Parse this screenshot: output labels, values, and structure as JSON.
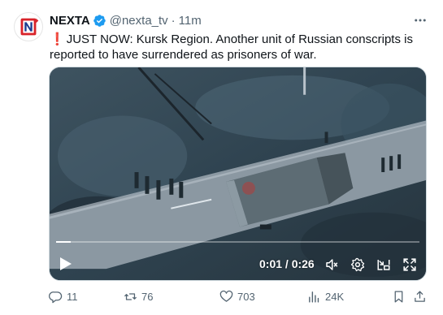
{
  "tweet": {
    "author_name": "NEXTA",
    "handle": "@nexta_tv",
    "separator": "·",
    "time": "11m",
    "exclamation": "❗",
    "text": "JUST NOW: Kursk Region. Another unit of Russian conscripts is reported to have surrendered as prisoners of war."
  },
  "video": {
    "time_display": "0:01 / 0:26",
    "progress_fraction": 0.04
  },
  "actions": {
    "replies": "11",
    "reposts": "76",
    "likes": "703",
    "views": "24K"
  },
  "colors": {
    "verified": "#1d9bf0",
    "avatar_red": "#d8232a",
    "avatar_blue": "#1d3d8f",
    "secondary_text": "#536471"
  },
  "icons": [
    "more-icon",
    "verified-badge-icon",
    "play-icon",
    "volume-icon",
    "settings-gear-icon",
    "picture-in-picture-icon",
    "fullscreen-icon",
    "reply-icon",
    "repost-icon",
    "like-icon",
    "views-icon",
    "bookmark-icon",
    "share-icon"
  ]
}
